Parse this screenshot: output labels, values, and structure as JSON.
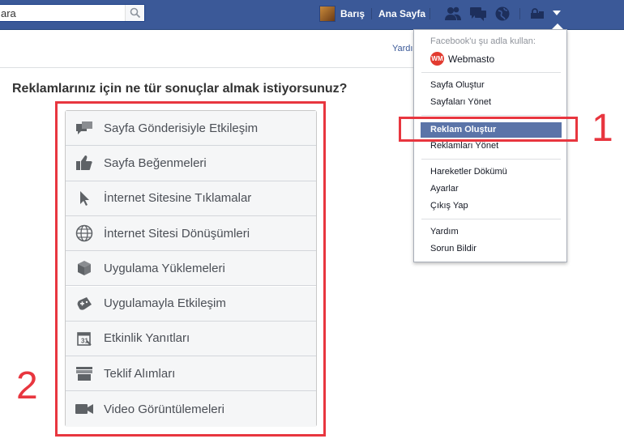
{
  "topbar": {
    "search_value": "ara",
    "profile_name": "Barış",
    "home_label": "Ana Sayfa",
    "icons": [
      "friend-requests-icon",
      "messages-icon",
      "notifications-globe-icon",
      "privacy-lock-icon",
      "account-caret-icon"
    ]
  },
  "page": {
    "help_link": "Yardım",
    "question": "Reklamlarınız için ne tür sonuçlar almak istiyorsunuz?"
  },
  "objectives": [
    {
      "label": "Sayfa Gönderisiyle Etkileşim",
      "icon": "post-engagement-icon"
    },
    {
      "label": "Sayfa Beğenmeleri",
      "icon": "thumbs-up-icon"
    },
    {
      "label": "İnternet Sitesine Tıklamalar",
      "icon": "cursor-icon"
    },
    {
      "label": "İnternet Sitesi Dönüşümleri",
      "icon": "globe-icon"
    },
    {
      "label": "Uygulama Yüklemeleri",
      "icon": "box-icon"
    },
    {
      "label": "Uygulamayla Etkileşim",
      "icon": "gamepad-icon"
    },
    {
      "label": "Etkinlik Yanıtları",
      "icon": "calendar-icon"
    },
    {
      "label": "Teklif Alımları",
      "icon": "store-icon"
    },
    {
      "label": "Video Görüntülemeleri",
      "icon": "video-camera-icon"
    }
  ],
  "menu": {
    "use_as_header": "Facebook'u şu adla kullan:",
    "page_badge": "WM",
    "page_name": "Webmasto",
    "items_group1": [
      "Sayfa Oluştur",
      "Sayfaları Yönet"
    ],
    "highlighted": "Reklam Oluştur",
    "manage_ads": "Reklamları Yönet",
    "items_group3": [
      "Hareketler Dökümü",
      "Ayarlar",
      "Çıkış Yap"
    ],
    "items_group4": [
      "Yardım",
      "Sorun Bildir"
    ]
  },
  "annotations": {
    "step1": "1",
    "step2": "2",
    "color": "#e8363f"
  }
}
